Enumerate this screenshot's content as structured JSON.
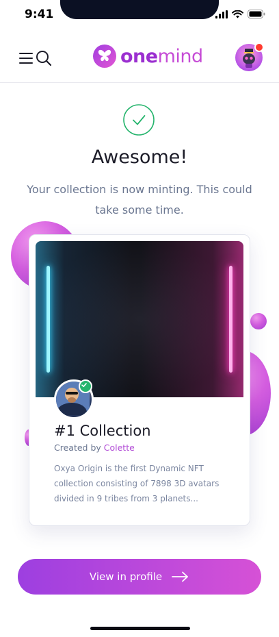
{
  "status_bar": {
    "time": "9:41"
  },
  "header": {
    "menu_icon": "hamburger-icon",
    "search_icon": "search-icon",
    "logo_part1": "one",
    "logo_part2": "mind",
    "has_notification": true
  },
  "success": {
    "icon": "check-circle-icon",
    "title": "Awesome!",
    "message": "Your collection is now minting. This could take some time."
  },
  "card": {
    "title": "#1 Collection",
    "created_by_label": "Created by",
    "creator_name": "Colette",
    "description": "Oxya Origin is the first Dynamic NFT collection consisting of 7898 3D avatars divided in 9 tribes from 3 planets...",
    "verified": true
  },
  "cta": {
    "label": "View in profile",
    "icon": "arrow-right-icon"
  },
  "colors": {
    "accent_purple": "#9d3fe0",
    "accent_pink": "#d651d6",
    "success_green": "#27b56e",
    "text_muted": "#6a7690"
  }
}
